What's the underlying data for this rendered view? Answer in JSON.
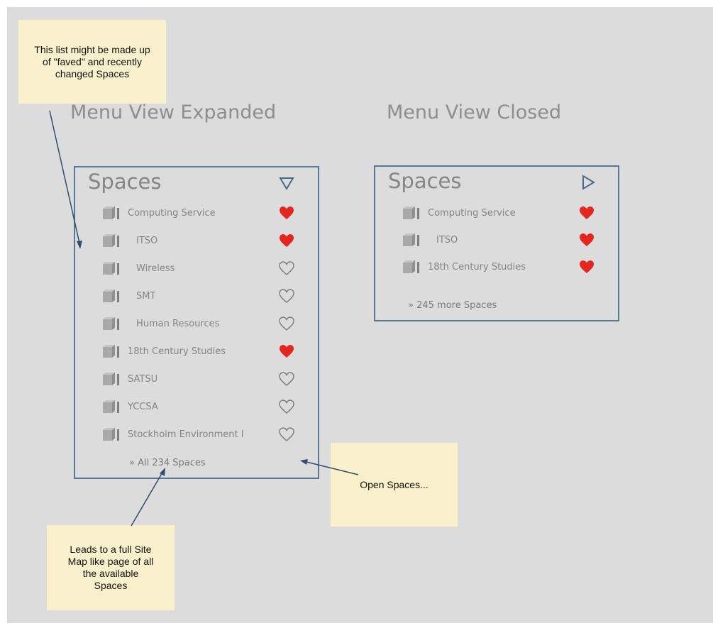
{
  "notes": {
    "top": "This list might be made up of \"faved\" and recently changed Spaces",
    "right": "Open Spaces...",
    "bottom": "Leads to a full Site Map like page of all the available Spaces"
  },
  "expanded": {
    "view_title": "Menu View Expanded",
    "panel_title": "Spaces",
    "toggle_icon": "triangle-down-icon",
    "items": [
      {
        "label": "Computing Service",
        "faved": true
      },
      {
        "label": "ITSO",
        "faved": true
      },
      {
        "label": "Wireless",
        "faved": false
      },
      {
        "label": "SMT",
        "faved": false
      },
      {
        "label": "Human Resources",
        "faved": false
      },
      {
        "label": "18th Century Studies",
        "faved": true
      },
      {
        "label": "SATSU",
        "faved": false
      },
      {
        "label": "YCCSA",
        "faved": false
      },
      {
        "label": "Stockholm Environment I",
        "faved": false
      }
    ],
    "more_link": "» All 234 Spaces"
  },
  "closed": {
    "view_title": "Menu View Closed",
    "panel_title": "Spaces",
    "toggle_icon": "triangle-right-icon",
    "items": [
      {
        "label": "Computing Service",
        "faved": true
      },
      {
        "label": "ITSO",
        "faved": true
      },
      {
        "label": "18th Century Studies",
        "faved": true
      }
    ],
    "more_link": "» 245 more Spaces"
  },
  "colors": {
    "background": "#dcdcdc",
    "note": "#fbf0cc",
    "panel_border": "#5a7795",
    "heart_filled": "#e4261f",
    "heart_outline": "#7b7b7b"
  }
}
